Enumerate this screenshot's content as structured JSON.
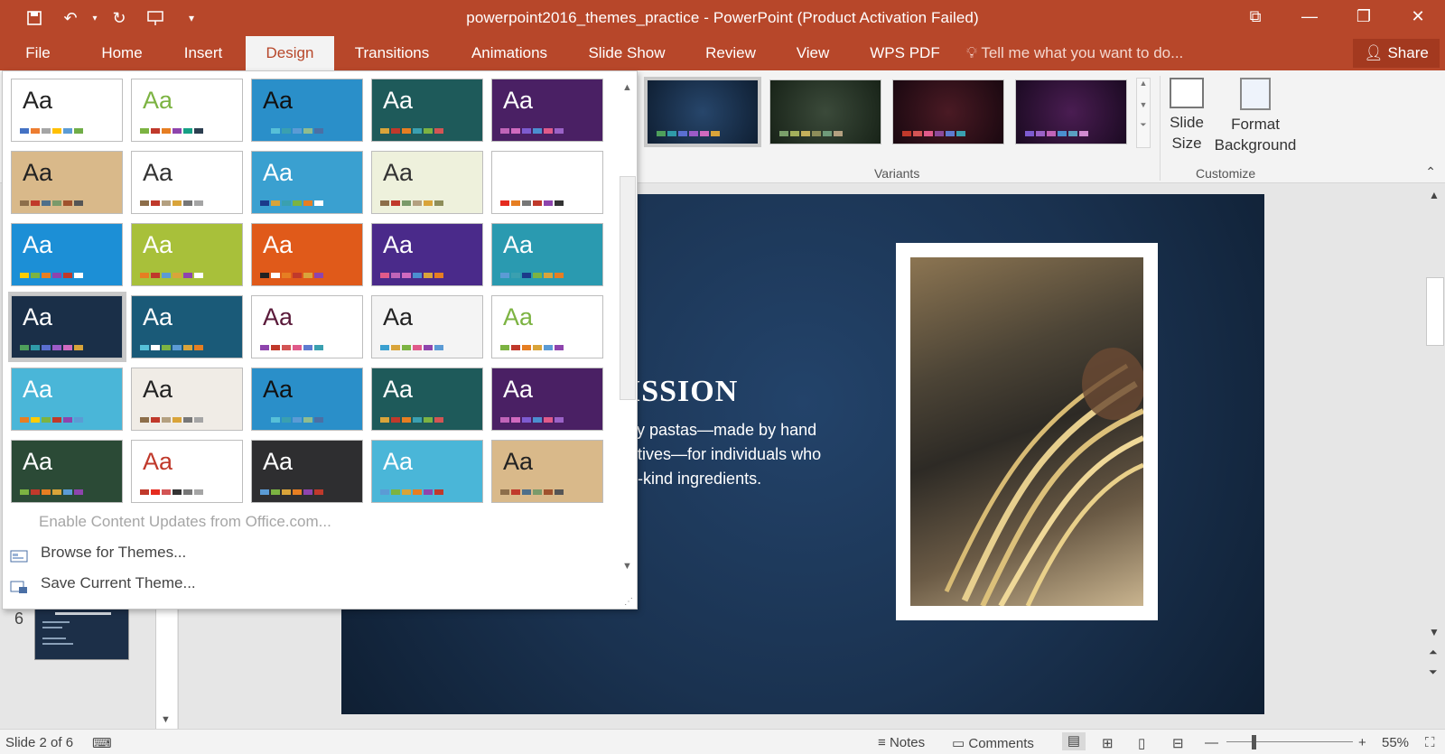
{
  "window": {
    "title": "powerpoint2016_themes_practice - PowerPoint (Product Activation Failed)"
  },
  "tabs": [
    "File",
    "Home",
    "Insert",
    "Design",
    "Transitions",
    "Animations",
    "Slide Show",
    "Review",
    "View",
    "WPS PDF"
  ],
  "active_tab": "Design",
  "tell_me": "Tell me what you want to do...",
  "share_label": "Share",
  "ribbon": {
    "variants_label": "Variants",
    "customize_label": "Customize",
    "slide_size_label": "Slide Size",
    "format_background_label": "Format Background"
  },
  "themes_gallery": {
    "menu": {
      "enable_updates": "Enable Content Updates from Office.com...",
      "browse": "Browse for Themes...",
      "save": "Save Current Theme..."
    },
    "preview_text": "Aa"
  },
  "slide": {
    "heading": "ISSION",
    "body_lines": [
      "ity pastas—made by hand",
      "atives—for individuals who",
      "a-kind ingredients."
    ]
  },
  "thumbnail_number": "6",
  "statusbar": {
    "slide_info": "Slide 2 of 6",
    "notes": "Notes",
    "comments": "Comments",
    "zoom": "55%"
  },
  "colors": {
    "title_bar": "#b7472a",
    "ribbon": "#f3f3f3",
    "slide_bg": "#1b3350"
  }
}
